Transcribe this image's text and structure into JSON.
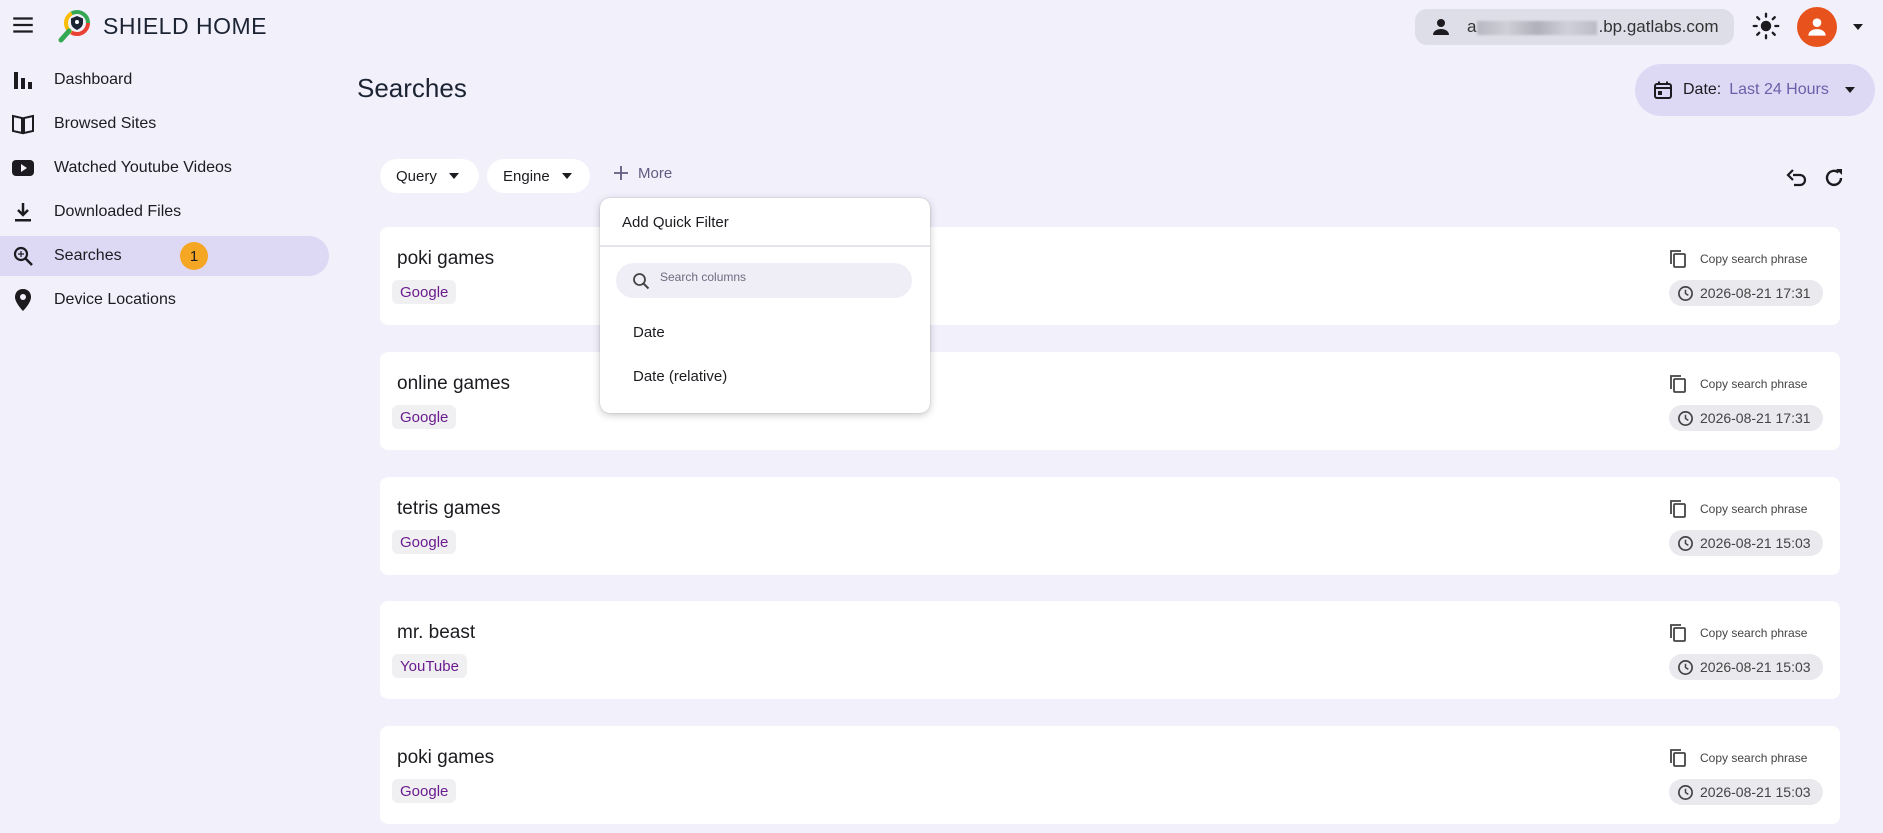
{
  "header": {
    "app_title": "SHIELD HOME",
    "account_email_start": "a",
    "account_email_end": ".bp.gatlabs.com",
    "avatar_color": "#e8531d"
  },
  "sidebar": {
    "items": [
      {
        "label": "Dashboard",
        "icon": "bar-chart-icon"
      },
      {
        "label": "Browsed Sites",
        "icon": "book-icon"
      },
      {
        "label": "Watched Youtube Videos",
        "icon": "youtube-icon"
      },
      {
        "label": "Downloaded Files",
        "icon": "download-icon"
      },
      {
        "label": "Searches",
        "icon": "search-icon",
        "active": true,
        "badge": "1"
      },
      {
        "label": "Device Locations",
        "icon": "location-pin-icon"
      }
    ]
  },
  "main": {
    "title": "Searches",
    "date_filter": {
      "key": "Date:",
      "value": "Last 24 Hours"
    },
    "filters": {
      "query": "Query",
      "engine": "Engine",
      "more": "More"
    }
  },
  "quick_filter": {
    "title": "Add Quick Filter",
    "search_placeholder": "Search columns",
    "options": [
      "Date",
      "Date (relative)"
    ]
  },
  "rows": [
    {
      "query": "poki games",
      "engine": "Google",
      "copy_label": "Copy search phrase",
      "time": "2026-08-21 17:31"
    },
    {
      "query": "online games",
      "engine": "Google",
      "copy_label": "Copy search phrase",
      "time": "2026-08-21 17:31"
    },
    {
      "query": "tetris games",
      "engine": "Google",
      "copy_label": "Copy search phrase",
      "time": "2026-08-21 15:03"
    },
    {
      "query": "mr. beast",
      "engine": "YouTube",
      "copy_label": "Copy search phrase",
      "time": "2026-08-21 15:03"
    },
    {
      "query": "poki games",
      "engine": "Google",
      "copy_label": "Copy search phrase",
      "time": "2026-08-21 15:03"
    }
  ],
  "colors": {
    "background": "#f1f0fb",
    "active_nav": "#ddd9f5",
    "badge": "#f5a623",
    "engine_text": "#6b1c8f"
  }
}
